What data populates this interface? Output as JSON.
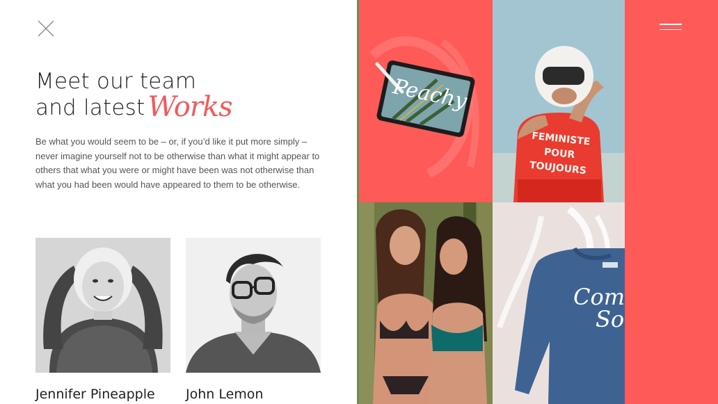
{
  "header": {
    "close_icon": "close-icon",
    "menu_icon": "hamburger-menu-icon"
  },
  "hero": {
    "title_line1": "Meet our team",
    "title_line2": "and latest",
    "title_script": "Works",
    "description": "Be what you would seem to be – or, if you’d like it put more simply – never imagine yourself not to be otherwise than what it might appear to others that what you were or might have been was not otherwise than what you had been would have appeared to them to be otherwise."
  },
  "team": [
    {
      "name": "Jennifer Pineapple"
    },
    {
      "name": "John Lemon"
    }
  ],
  "works": {
    "tablet_text": "Peachy",
    "shirt_line1": "FEMINISTE",
    "shirt_line2": "POUR",
    "shirt_line3": "TOUJOURS",
    "sweater_line1": "Com",
    "sweater_line2": "Soo"
  },
  "colors": {
    "accent": "#f25a5a",
    "coral": "#fd5a58",
    "sky": "#9fc2cf",
    "sweater": "#3e6392"
  }
}
